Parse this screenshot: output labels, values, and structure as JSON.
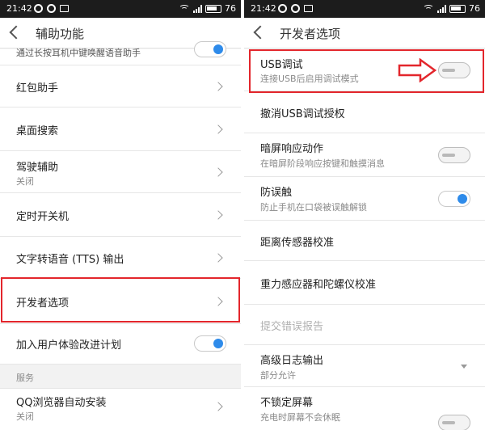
{
  "left": {
    "status": {
      "time": "21:42",
      "battery": "76"
    },
    "title": "辅助功能",
    "items": [
      {
        "label": "通过长按耳机中键唤醒语音助手",
        "type": "toggle-partial"
      },
      {
        "label": "红包助手",
        "type": "chevron"
      },
      {
        "label": "桌面搜索",
        "type": "chevron"
      },
      {
        "label": "驾驶辅助",
        "sub": "关闭",
        "type": "chevron"
      },
      {
        "label": "定时开关机",
        "type": "chevron"
      },
      {
        "label": "文字转语音 (TTS) 输出",
        "type": "chevron"
      },
      {
        "label": "开发者选项",
        "type": "chevron"
      },
      {
        "label": "加入用户体验改进计划",
        "type": "toggle-on"
      }
    ],
    "section": "服务",
    "service_items": [
      {
        "label": "QQ浏览器自动安装",
        "sub": "关闭",
        "type": "chevron"
      }
    ]
  },
  "right": {
    "status": {
      "time": "21:42",
      "battery": "76"
    },
    "title": "开发者选项",
    "items": [
      {
        "label": "USB调试",
        "sub": "连接USB后启用调试模式",
        "type": "toggle-off"
      },
      {
        "label": "撤消USB调试授权",
        "type": "none"
      },
      {
        "label": "暗屏响应动作",
        "sub": "在暗屏阶段响应按键和触摸消息",
        "type": "toggle-off"
      },
      {
        "label": "防误触",
        "sub": "防止手机在口袋被误触解锁",
        "type": "toggle-on"
      },
      {
        "label": "距离传感器校准",
        "type": "none"
      },
      {
        "label": "重力感应器和陀螺仪校准",
        "type": "none"
      },
      {
        "label": "提交错误报告",
        "type": "disabled"
      },
      {
        "label": "高级日志输出",
        "sub": "部分允许",
        "type": "dropdown"
      },
      {
        "label": "不锁定屏幕",
        "sub": "充电时屏幕不会休眠",
        "type": "toggle-off"
      }
    ]
  },
  "colors": {
    "highlight": "#e3262c",
    "toggle_on": "#2e8bea",
    "statusbar": "#1c1c1c"
  }
}
